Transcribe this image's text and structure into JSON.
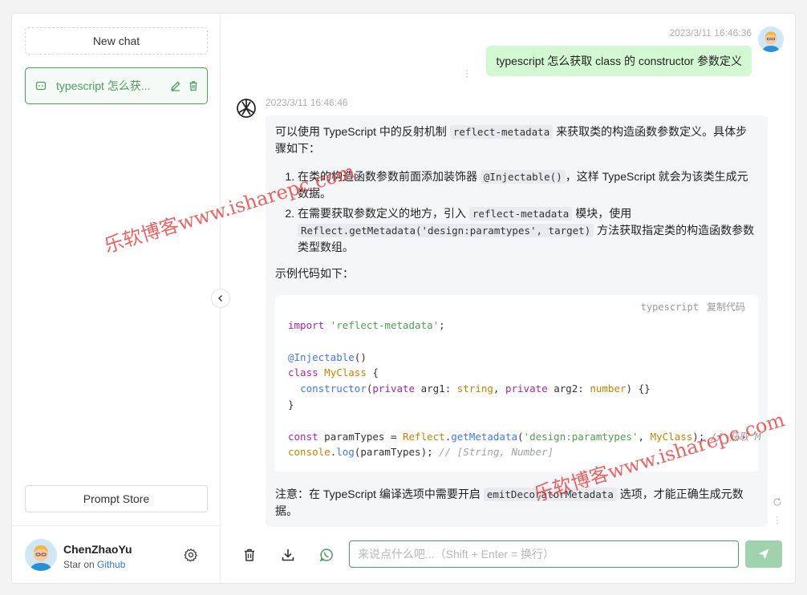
{
  "sidebar": {
    "new_chat_label": "New chat",
    "history": [
      {
        "title": "typescript 怎么获..."
      }
    ],
    "prompt_store_label": "Prompt Store",
    "user": {
      "name": "ChenZhaoYu",
      "sub_prefix": "Star on",
      "sub_link": "Github"
    }
  },
  "chat": {
    "user_message": {
      "time": "2023/3/11 16:46:36",
      "text": "typescript 怎么获取 class 的 constructor 参数定义"
    },
    "ai_message": {
      "time": "2023/3/11 16:46:46",
      "intro_a": "可以使用 TypeScript 中的反射机制 ",
      "intro_code": "reflect-metadata",
      "intro_b": " 来获取类的构造函数参数定义。具体步骤如下：",
      "step1_a": "在类的构造函数参数前面添加装饰器 ",
      "step1_code": "@Injectable()",
      "step1_b": "，这样 TypeScript 就会为该类生成元数据。",
      "step2_a": "在需要获取参数定义的地方，引入 ",
      "step2_code1": "reflect-metadata",
      "step2_b": " 模块，使用 ",
      "step2_code2": "Reflect.getMetadata('design:paramtypes', target)",
      "step2_c": " 方法获取指定类的构造函数参数类型数组。",
      "example_label": "示例代码如下：",
      "code_lang": "typescript",
      "copy_label": "复制代码",
      "note_a": "注意：在 TypeScript 编译选项中需要开启 ",
      "note_code": "emitDecoratorMetadata",
      "note_b": " 选项，才能正确生成元数据。"
    },
    "input_placeholder": "来说点什么吧...（Shift + Enter = 换行）"
  },
  "watermark": {
    "text": "乐软博客www.isharepc.com"
  },
  "colors": {
    "accent": "#4b9e5f",
    "user_bubble": "#d2f9d1",
    "send_button": "#9fd3ad"
  }
}
